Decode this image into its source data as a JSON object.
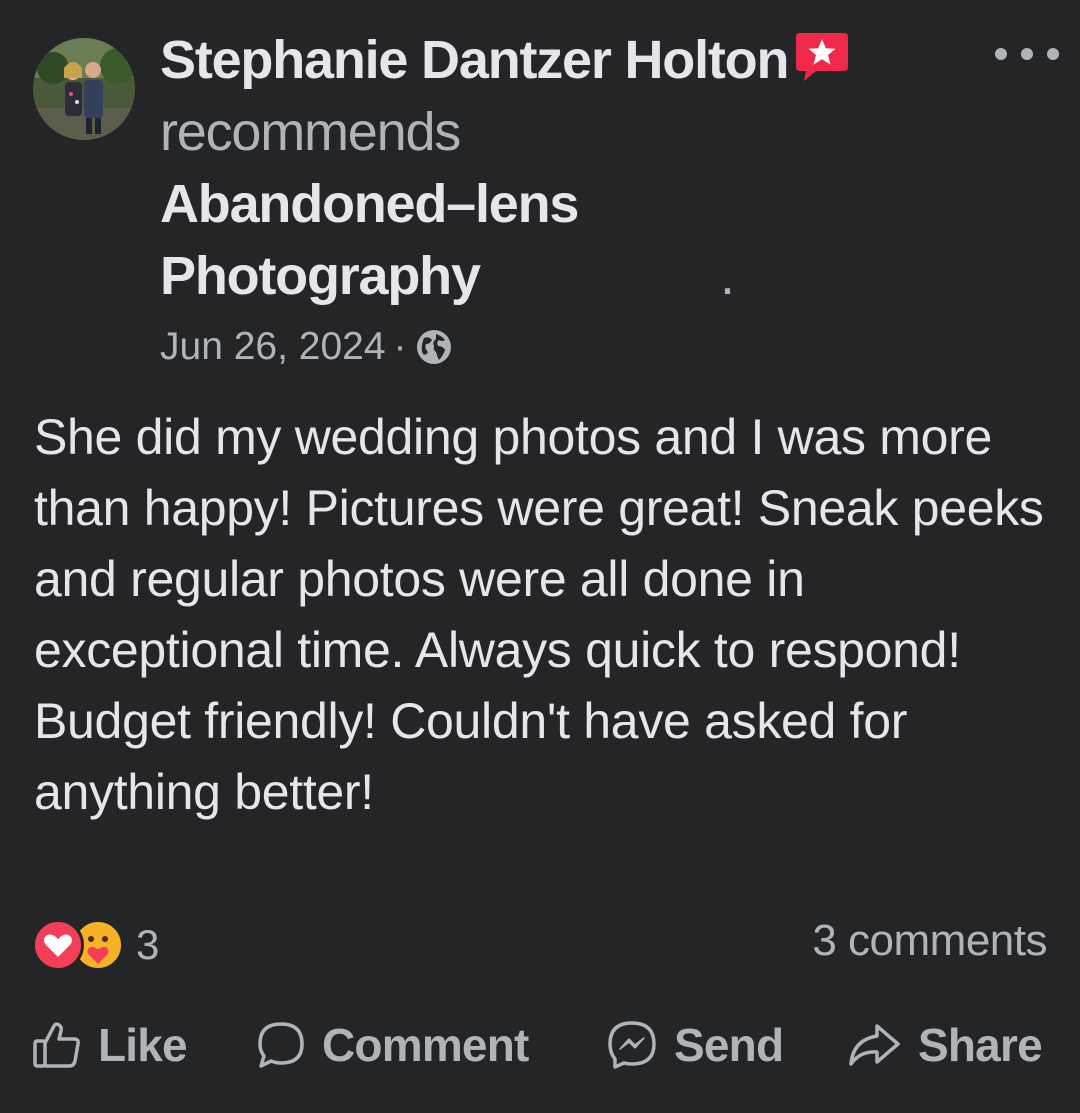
{
  "post": {
    "author": "Stephanie Dantzer Holton",
    "verb": "recommends",
    "target": "Abandoned–lens Photography",
    "period": ".",
    "date": "Jun 26, 2024",
    "separator": "·",
    "audience_icon": "globe-icon",
    "badge_icon": "recommendation-star-icon",
    "more_icon": "more-options-icon",
    "body": "She did my wedding photos and I was more than happy! Pictures were great! Sneak peeks and regular photos were all done in exceptional time. Always quick to respond! Budget friendly! Couldn't have asked for anything better!"
  },
  "engagement": {
    "reaction_icons": [
      "love-reaction-icon",
      "care-reaction-icon"
    ],
    "reaction_count": "3",
    "comments": "3 comments"
  },
  "actions": {
    "like": "Like",
    "comment": "Comment",
    "send": "Send",
    "share": "Share"
  },
  "colors": {
    "background": "#242526",
    "primary_text": "#e4e6eb",
    "secondary_text": "#b0b3b8",
    "badge": "#f02849",
    "love": "#f33e58",
    "care": "#f7b125"
  }
}
